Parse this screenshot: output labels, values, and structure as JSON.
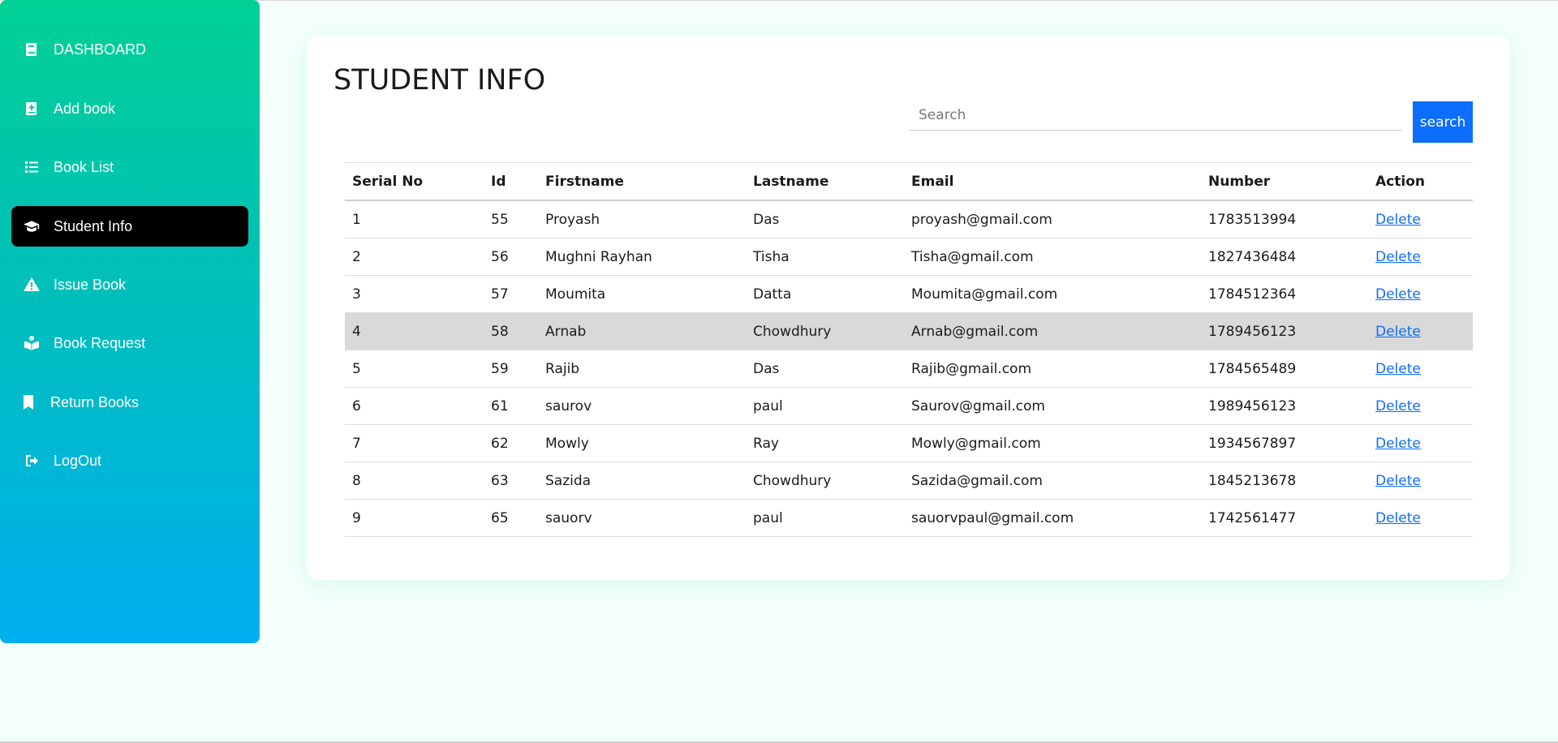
{
  "sidebar": {
    "items": [
      {
        "label": "DASHBOARD",
        "icon": "book-icon",
        "active": false
      },
      {
        "label": "Add book",
        "icon": "book-add-icon",
        "active": false
      },
      {
        "label": "Book List",
        "icon": "list-icon",
        "active": false
      },
      {
        "label": "Student Info",
        "icon": "graduation-cap-icon",
        "active": true
      },
      {
        "label": "Issue Book",
        "icon": "warning-icon",
        "active": false
      },
      {
        "label": "Book Request",
        "icon": "book-reader-icon",
        "active": false
      },
      {
        "label": "Return Books",
        "icon": "bookmark-icon",
        "active": false
      },
      {
        "label": "LogOut",
        "icon": "logout-icon",
        "active": false
      }
    ]
  },
  "main": {
    "title": "STUDENT INFO",
    "search": {
      "placeholder": "Search",
      "value": "",
      "button_label": "search"
    },
    "table": {
      "columns": [
        "Serial No",
        "Id",
        "Firstname",
        "Lastname",
        "Email",
        "Number",
        "Action"
      ],
      "rows": [
        [
          "1",
          "55",
          "Proyash",
          "Das",
          "proyash@gmail.com",
          "1783513994",
          "Delete"
        ],
        [
          "2",
          "56",
          "Mughni Rayhan",
          "Tisha",
          "Tisha@gmail.com",
          "1827436484",
          "Delete"
        ],
        [
          "3",
          "57",
          "Moumita",
          "Datta",
          "Moumita@gmail.com",
          "1784512364",
          "Delete"
        ],
        [
          "4",
          "58",
          "Arnab",
          "Chowdhury",
          "Arnab@gmail.com",
          "1789456123",
          "Delete"
        ],
        [
          "5",
          "59",
          "Rajib",
          "Das",
          "Rajib@gmail.com",
          "1784565489",
          "Delete"
        ],
        [
          "6",
          "61",
          "saurov",
          "paul",
          "Saurov@gmail.com",
          "1989456123",
          "Delete"
        ],
        [
          "7",
          "62",
          "Mowly",
          "Ray",
          "Mowly@gmail.com",
          "1934567897",
          "Delete"
        ],
        [
          "8",
          "63",
          "Sazida",
          "Chowdhury",
          "Sazida@gmail.com",
          "1845213678",
          "Delete"
        ],
        [
          "9",
          "65",
          "sauorv",
          "paul",
          "sauorvpaul@gmail.com",
          "1742561477",
          "Delete"
        ]
      ],
      "highlighted_row": 3
    }
  },
  "colors": {
    "sidebar_top": "#00d094",
    "sidebar_bottom": "#00aff0",
    "accent": "#0d6efd",
    "active_item": "#000000",
    "highlight_row": "#d9d9d9"
  }
}
